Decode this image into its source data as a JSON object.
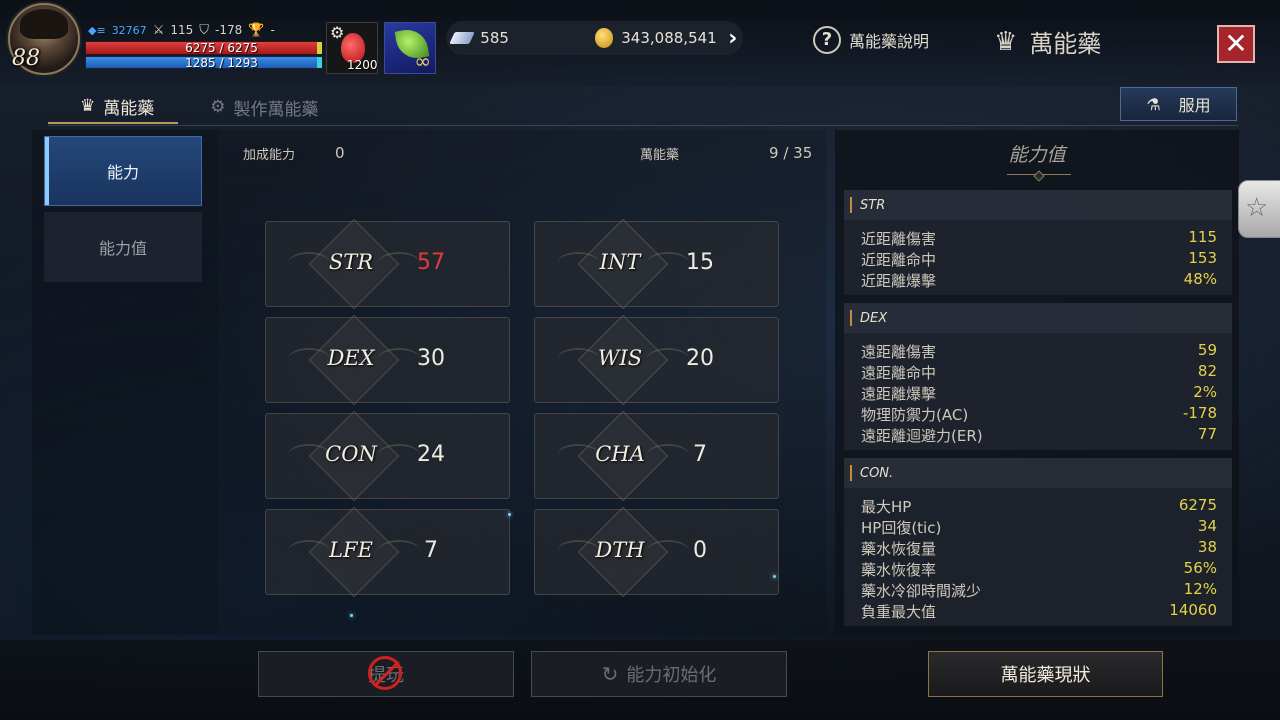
{
  "player": {
    "level": "88",
    "power": "32767",
    "attack": "115",
    "defense": "-178",
    "trophy": "-",
    "hp_text": "6275 / 6275",
    "mp_text": "1285 / 1293"
  },
  "quick_items": {
    "potion_count": "1200"
  },
  "currency": {
    "diamonds": "585",
    "gold": "343,088,541"
  },
  "header": {
    "help_label": "萬能藥說明",
    "title": "萬能藥"
  },
  "tabs": [
    {
      "label": "萬能藥",
      "active": true
    },
    {
      "label": "製作萬能藥",
      "active": false
    }
  ],
  "take_button_label": "服用",
  "side_nav": [
    {
      "label": "能力",
      "active": true
    },
    {
      "label": "能力值",
      "active": false
    }
  ],
  "center": {
    "bonus_label": "加成能力",
    "bonus_value": "0",
    "elixir_label": "萬能藥",
    "elixir_value": "9 / 35",
    "stats": [
      {
        "name": "STR",
        "value": "57",
        "highlight": true
      },
      {
        "name": "INT",
        "value": "15",
        "highlight": false
      },
      {
        "name": "DEX",
        "value": "30",
        "highlight": false
      },
      {
        "name": "WIS",
        "value": "20",
        "highlight": false
      },
      {
        "name": "CON",
        "value": "24",
        "highlight": false
      },
      {
        "name": "CHA",
        "value": "7",
        "highlight": false
      },
      {
        "name": "LFE",
        "value": "7",
        "highlight": false
      },
      {
        "name": "DTH",
        "value": "0",
        "highlight": false
      }
    ]
  },
  "right_panel": {
    "title": "能力值",
    "groups": [
      {
        "name": "STR",
        "rows": [
          {
            "label": "近距離傷害",
            "value": "115"
          },
          {
            "label": "近距離命中",
            "value": "153"
          },
          {
            "label": "近距離爆擊",
            "value": "48%"
          }
        ]
      },
      {
        "name": "DEX",
        "rows": [
          {
            "label": "遠距離傷害",
            "value": "59"
          },
          {
            "label": "遠距離命中",
            "value": "82"
          },
          {
            "label": "遠距離爆擊",
            "value": "2%"
          },
          {
            "label": "物理防禦力(AC)",
            "value": "-178"
          },
          {
            "label": "遠距離迴避力(ER)",
            "value": "77"
          }
        ]
      },
      {
        "name": "CON.",
        "rows": [
          {
            "label": "最大HP",
            "value": "6275"
          },
          {
            "label": "HP回復(tic)",
            "value": "34"
          },
          {
            "label": "藥水恢復量",
            "value": "38"
          },
          {
            "label": "藥水恢復率",
            "value": "56%"
          },
          {
            "label": "藥水冷卻時間減少",
            "value": "12%"
          },
          {
            "label": "負重最大值",
            "value": "14060"
          }
        ]
      }
    ]
  },
  "bottom": {
    "disabled_btn_label": "提玩",
    "reset_label": "能力初始化",
    "status_label": "萬能藥現狀"
  },
  "colors": {
    "highlight_value": "#e23b3b",
    "stat_value": "#e5d24a",
    "active_nav": "#24477a",
    "close_button": "#a5252b"
  }
}
